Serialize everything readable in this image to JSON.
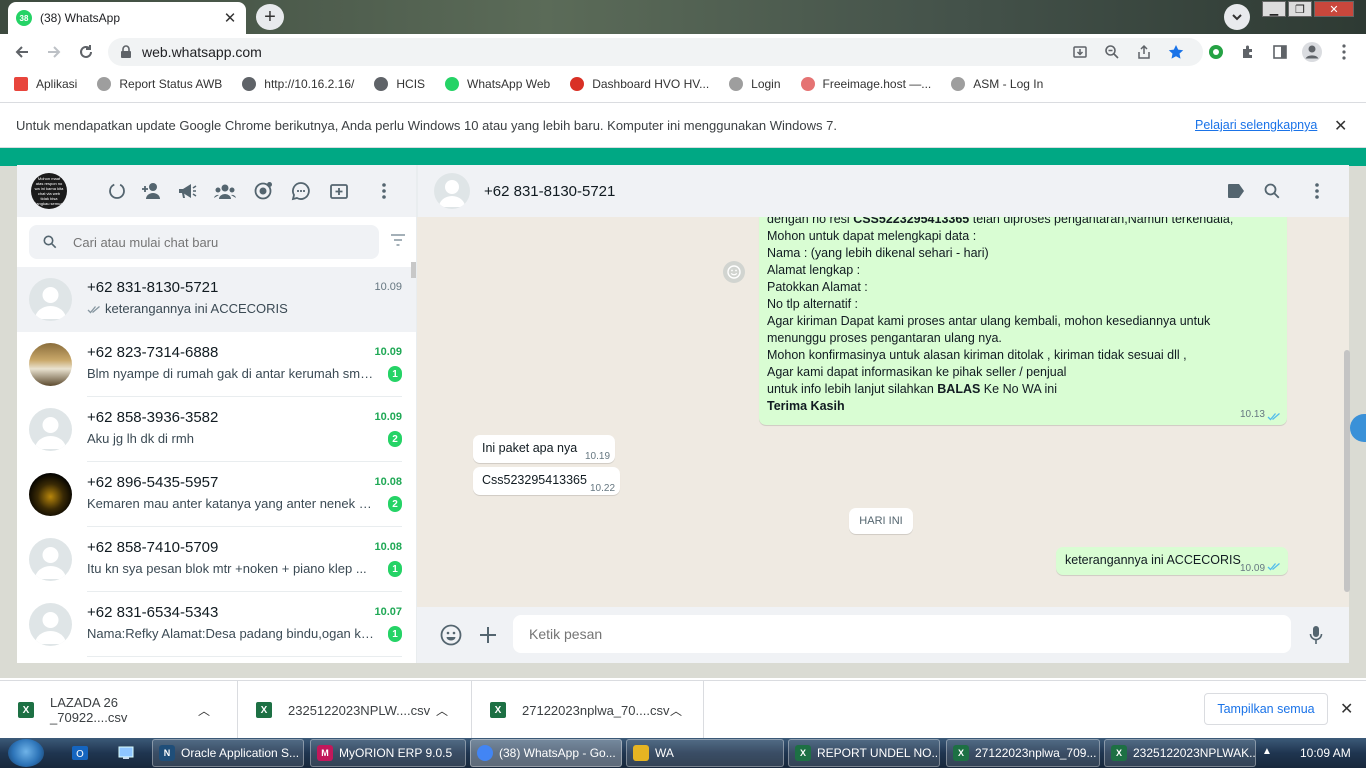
{
  "browser": {
    "tab_title": "(38) WhatsApp",
    "tab_badge": "38",
    "url": "web.whatsapp.com"
  },
  "bookmarks": [
    {
      "label": "Aplikasi",
      "color": "#e8453c"
    },
    {
      "label": "Report Status AWB",
      "color": "#9e9e9e"
    },
    {
      "label": "http://10.16.2.16/",
      "color": "#5f6368"
    },
    {
      "label": "HCIS",
      "color": "#5f6368"
    },
    {
      "label": "WhatsApp Web",
      "color": "#25d366"
    },
    {
      "label": "Dashboard HVO HV...",
      "color": "#d93025"
    },
    {
      "label": "Login",
      "color": "#9e9e9e"
    },
    {
      "label": "Freeimage.host —...",
      "color": "#e57373"
    },
    {
      "label": "ASM - Log In",
      "color": "#9e9e9e"
    }
  ],
  "infobar": {
    "text": "Untuk mendapatkan update Google Chrome berikutnya, Anda perlu Windows 10 atau yang lebih baru. Komputer ini menggunakan Windows 7.",
    "link": "Pelajari selengkapnya"
  },
  "profile": {
    "avatar_text": "Mohon maaf atas respon no wa ini karna kita chat via web tidak bisa jangkau semua"
  },
  "sidebar": {
    "search_placeholder": "Cari atau mulai chat baru",
    "chats": [
      {
        "name": "+62 831-8130-5721",
        "time": "10.09",
        "msg": "keterangannya ini ACCECORIS",
        "unread": "",
        "ticks": true,
        "avatar": "default"
      },
      {
        "name": "+62 823-7314-6888",
        "time": "10.09",
        "msg": "Blm nyampe di rumah gak di antar kerumah sma...",
        "unread": "1",
        "ticks": false,
        "avatar": "photo1"
      },
      {
        "name": "+62 858-3936-3582",
        "time": "10.09",
        "msg": "Aku jg lh dk di rmh",
        "unread": "2",
        "ticks": false,
        "avatar": "default"
      },
      {
        "name": "+62 896-5435-5957",
        "time": "10.08",
        "msg": "Kemaren mau anter katanya yang anter nenek ny...",
        "unread": "2",
        "ticks": false,
        "avatar": "photo2"
      },
      {
        "name": "+62 858-7410-5709",
        "time": "10.08",
        "msg": "Itu kn sya pesan blok mtr +noken + piano klep ...",
        "unread": "1",
        "ticks": false,
        "avatar": "default"
      },
      {
        "name": "+62 831-6534-5343",
        "time": "10.07",
        "msg": "Nama:Refky Alamat:Desa padang bindu,ogan ko...",
        "unread": "1",
        "ticks": false,
        "avatar": "default"
      }
    ]
  },
  "conversation": {
    "contact": "+62 831-8130-5721",
    "big_message": {
      "line0_pre": "dengan no resi ",
      "line0_bold": "CSS5223295413365",
      "line0_post": " telah diproses pengantaran,Namun terkendala,",
      "lines": [
        "Mohon untuk dapat melengkapi data :",
        "Nama : (yang lebih dikenal sehari - hari)",
        "Alamat  lengkap :",
        "Patokkan Alamat :",
        "No tlp alternatif :",
        "Agar kiriman Dapat kami proses antar ulang kembali, mohon kesediannya untuk",
        "menunggu proses pengantaran ulang nya.",
        "Mohon konfirmasinya untuk alasan kiriman ditolak , kiriman tidak sesuai dll ,",
        "Agar kami dapat informasikan ke pihak seller / penjual"
      ],
      "balas_pre": "untuk info lebih lanjut silahkan ",
      "balas_bold": "BALAS",
      "balas_post": " Ke No WA ini",
      "closing": "Terima Kasih",
      "time": "10.13"
    },
    "incoming": [
      {
        "text": "Ini paket apa nya",
        "time": "10.19"
      },
      {
        "text": "Css523295413365",
        "time": "10.22"
      }
    ],
    "day_label": "HARI INI",
    "last_out": {
      "text": "keterangannya ini ACCECORIS",
      "time": "10.09"
    },
    "input_placeholder": "Ketik pesan"
  },
  "downloads": {
    "files": [
      "LAZADA 26 _70922....csv",
      "2325122023NPLW....csv",
      "27122023nplwa_70....csv"
    ],
    "show_all": "Tampilkan semua"
  },
  "taskbar": {
    "tasks": [
      {
        "label": "Oracle Application S...",
        "color": "#1f4e79",
        "glyph": "N"
      },
      {
        "label": "MyORION ERP 9.0.5",
        "color": "#c2185b",
        "glyph": "M"
      },
      {
        "label": "(38) WhatsApp - Go...",
        "color": "#4285f4",
        "glyph": ""
      },
      {
        "label": "WA",
        "color": "#e6b422",
        "glyph": ""
      },
      {
        "label": "REPORT UNDEL NO...",
        "color": "#1d7044",
        "glyph": "X"
      },
      {
        "label": "27122023nplwa_709...",
        "color": "#1d7044",
        "glyph": "X"
      },
      {
        "label": "2325122023NPLWAK...",
        "color": "#1d7044",
        "glyph": "X"
      }
    ],
    "clock": "10:09 AM"
  },
  "colors": {
    "wa_green": "#00a884",
    "unread_green": "#25d366",
    "outgoing_bubble": "#d9fdd3",
    "tick_blue": "#53bdeb"
  }
}
